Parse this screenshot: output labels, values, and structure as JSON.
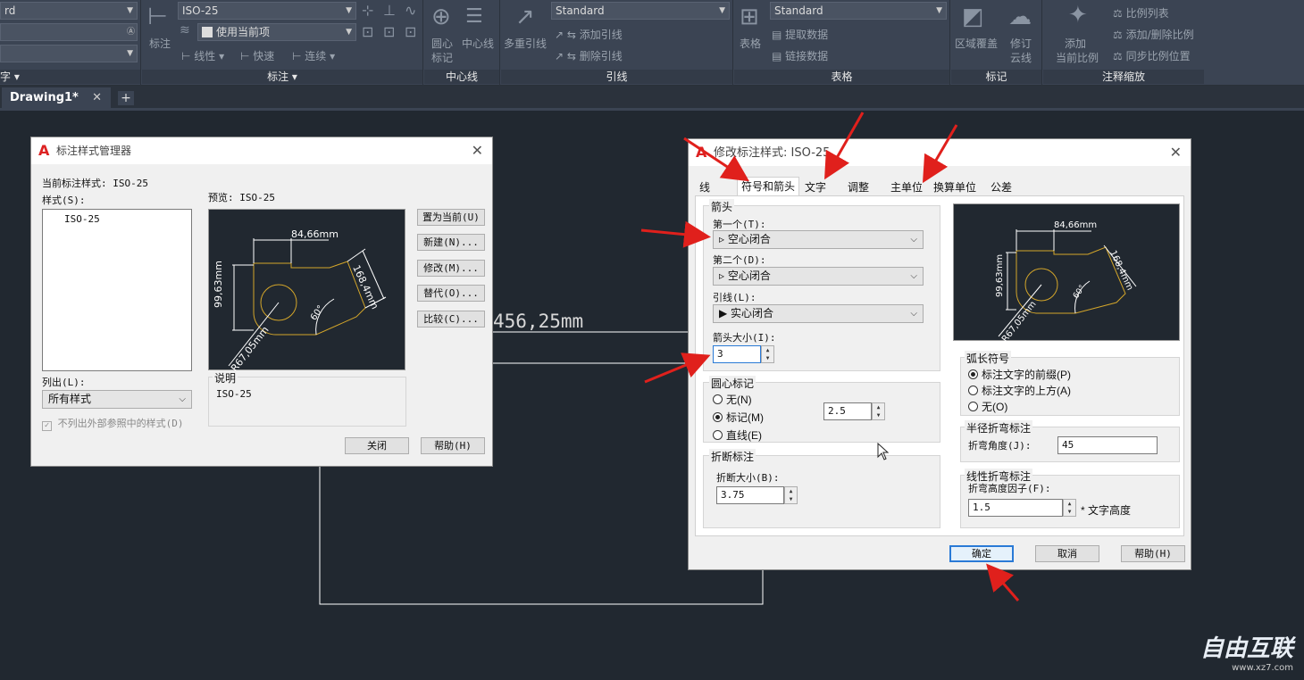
{
  "ribbon": {
    "left_combo1": "rd",
    "left_combo3": "字 ▾",
    "dim_style": "ISO-25",
    "use_current": "使用当前项",
    "dim_btn": "标注",
    "linear": "线性",
    "quick": "快速",
    "continue": "连续",
    "dim_panel": "标注 ▾",
    "center_mark": "圆心\n标记",
    "center_mark1": "圆心",
    "center_mark2": "标记",
    "center_line": "中心线",
    "center_panel": "中心线",
    "multileader": "多重引线",
    "leader_style": "Standard",
    "add_leader": "添加引线",
    "del_leader": "删除引线",
    "leader_panel": "引线",
    "table": "表格",
    "table_style": "Standard",
    "extract": "提取数据",
    "link": "链接数据",
    "table_panel": "表格",
    "wipeout": "区域覆盖",
    "revcloud1": "修订",
    "revcloud2": "云线",
    "markup_panel": "标记",
    "add1": "添加",
    "add2": "当前比例",
    "scale_list": "比例列表",
    "add_del_scale": "添加/删除比例",
    "sync_scale": "同步比例位置",
    "anno_panel": "注释缩放"
  },
  "tabs": {
    "doc": "Drawing1*",
    "close": "✕",
    "plus": "+"
  },
  "drawing": {
    "dim_text": "456,25mm"
  },
  "mgr": {
    "title": "标注样式管理器",
    "close": "✕",
    "current_label": "当前标注样式: ISO-25",
    "styles_label": "样式(S):",
    "style_item": "ISO-25",
    "preview_label": "预览: ISO-25",
    "list_label": "列出(L):",
    "list_value": "所有样式",
    "xref_check": "不列出外部参照中的样式(D)",
    "desc_label": "说明",
    "desc_value": "ISO-25",
    "set_current": "置为当前(U)",
    "new": "新建(N)...",
    "modify": "修改(M)...",
    "override": "替代(O)...",
    "compare": "比较(C)...",
    "close_btn": "关闭",
    "help_btn": "帮助(H)"
  },
  "mod": {
    "title": "修改标注样式: ISO-25",
    "close": "✕",
    "tabs": [
      "线",
      "符号和箭头",
      "文字",
      "调整",
      "主单位",
      "换算单位",
      "公差"
    ],
    "arrow_group": "箭头",
    "first_label": "第一个(T):",
    "first_value": "空心闭合",
    "second_label": "第二个(D):",
    "second_value": "空心闭合",
    "leader_label": "引线(L):",
    "leader_value": "实心闭合",
    "arrow_size_label": "箭头大小(I):",
    "arrow_size_value": "3",
    "center_group": "圆心标记",
    "c_none": "无(N)",
    "c_mark": "标记(M)",
    "c_line": "直线(E)",
    "center_size": "2.5",
    "break_group": "折断标注",
    "break_size_label": "折断大小(B):",
    "break_size_value": "3.75",
    "arc_group": "弧长符号",
    "arc_prefix": "标注文字的前缀(P)",
    "arc_above": "标注文字的上方(A)",
    "arc_none": "无(O)",
    "radius_group": "半径折弯标注",
    "jog_angle_label": "折弯角度(J):",
    "jog_angle_value": "45",
    "linear_jog_group": "线性折弯标注",
    "jog_height_label": "折弯高度因子(F):",
    "jog_height_value": "1.5",
    "text_height": "* 文字高度",
    "ok": "确定",
    "cancel": "取消",
    "help": "帮助(H)"
  },
  "preview_dims": {
    "top": "84,66mm",
    "left": "99,63mm",
    "right": "168,4mm",
    "angle": "60°",
    "radius": "R67,05mm"
  },
  "watermark": {
    "brand": "自由互联",
    "url": "www.xz7.com"
  },
  "colors": {
    "accent_arrow": "#e0201c",
    "canvas": "#212830",
    "ribbon": "#3b4453"
  }
}
